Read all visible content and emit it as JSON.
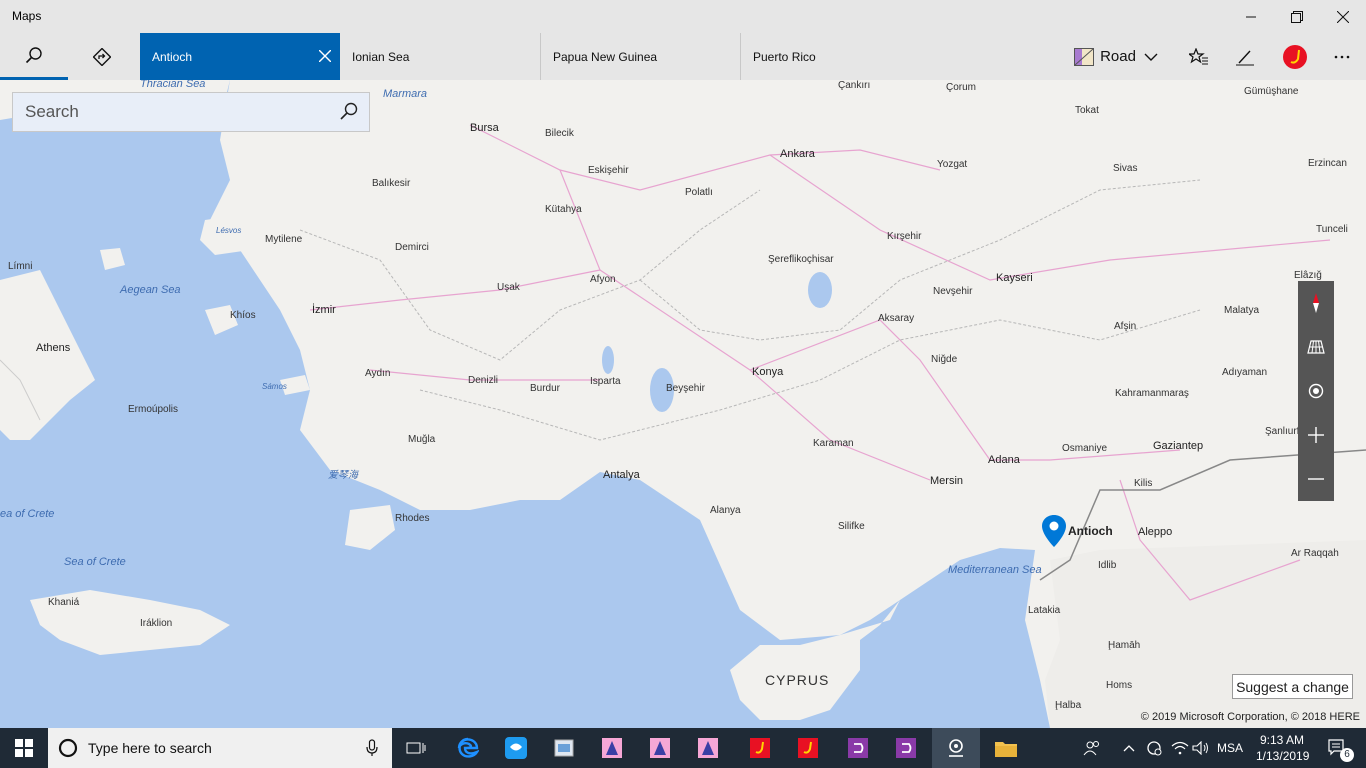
{
  "window": {
    "title": "Maps"
  },
  "tabs": [
    {
      "label": "Antioch"
    },
    {
      "label": "Ionian Sea"
    },
    {
      "label": "Papua New Guinea"
    },
    {
      "label": "Puerto Rico"
    }
  ],
  "header": {
    "map_style": "Road"
  },
  "search": {
    "placeholder": "Search"
  },
  "map": {
    "pin_label": "Antioch",
    "labels": {
      "thracian": "Thracian Sea",
      "marmara": "Marmara",
      "aegean": "Aegean Sea",
      "crete1": "ea of Crete",
      "crete2": "Sea of Crete",
      "med": "Mediterranean Sea",
      "samos": "Sámos",
      "lesvos": "Lésvos",
      "bursa": "Bursa",
      "bilecik": "Bilecik",
      "eskisehir": "Eskişehir",
      "ankara": "Ankara",
      "polatli": "Polatlı",
      "balikesir": "Balıkesir",
      "kutahya": "Kütahya",
      "mytilene": "Mytilene",
      "demirci": "Demirci",
      "limni": "Límni",
      "usak": "Uşak",
      "afyon": "Afyon",
      "izmir": "İzmir",
      "athens": "Athens",
      "khios": "Khíos",
      "aydin": "Aydın",
      "denizli": "Denizli",
      "burdur": "Burdur",
      "isparta": "Isparta",
      "beysehir": "Beyşehir",
      "konya": "Konya",
      "ermoupolis": "Ermoúpolis",
      "mugla": "Muğla",
      "chinese": "爱琴海",
      "antalya": "Antalya",
      "alanya": "Alanya",
      "karaman": "Karaman",
      "silifke": "Silifke",
      "mersin": "Mersin",
      "adana": "Adana",
      "osmaniye": "Osmaniye",
      "kilis": "Kilis",
      "gaziantep": "Gaziantep",
      "aleppo": "Aleppo",
      "idlib": "Idlib",
      "latakia": "Latakia",
      "hamah": "Ḩamāh",
      "homs": "Homs",
      "haloa": "Ḩalba",
      "rhodes": "Rhodes",
      "khania": "Khaniá",
      "iraklion": "Iráklion",
      "cyprus": "CYPRUS",
      "arraqqah": "Ar Raqqah",
      "sanliurfa": "Şanlıurf",
      "adiyaman": "Adıyaman",
      "kahramanmaras": "Kahramanmaraş",
      "malatya": "Malatya",
      "afsin": "Afşin",
      "elazig": "Elâzığ",
      "kayseri": "Kayseri",
      "nevsehir": "Nevşehir",
      "aksaray": "Aksaray",
      "nigde": "Niğde",
      "serefli": "Şereflikoçhisar",
      "kirsehir": "Kırşehir",
      "yozgat": "Yozgat",
      "sivas": "Sivas",
      "tokat": "Tokat",
      "corum": "Çorum",
      "cankiri": "Çankırı",
      "gumushane": "Gümüşhane",
      "erzincan": "Erzincan",
      "tunceli": "Tunceli"
    },
    "suggest": "Suggest a change",
    "copyright": "© 2019 Microsoft Corporation, © 2018 HERE"
  },
  "taskbar": {
    "search_placeholder": "Type here to search",
    "language": "MSA",
    "time": "9:13 AM",
    "date": "1/13/2019",
    "notifications": "6"
  }
}
